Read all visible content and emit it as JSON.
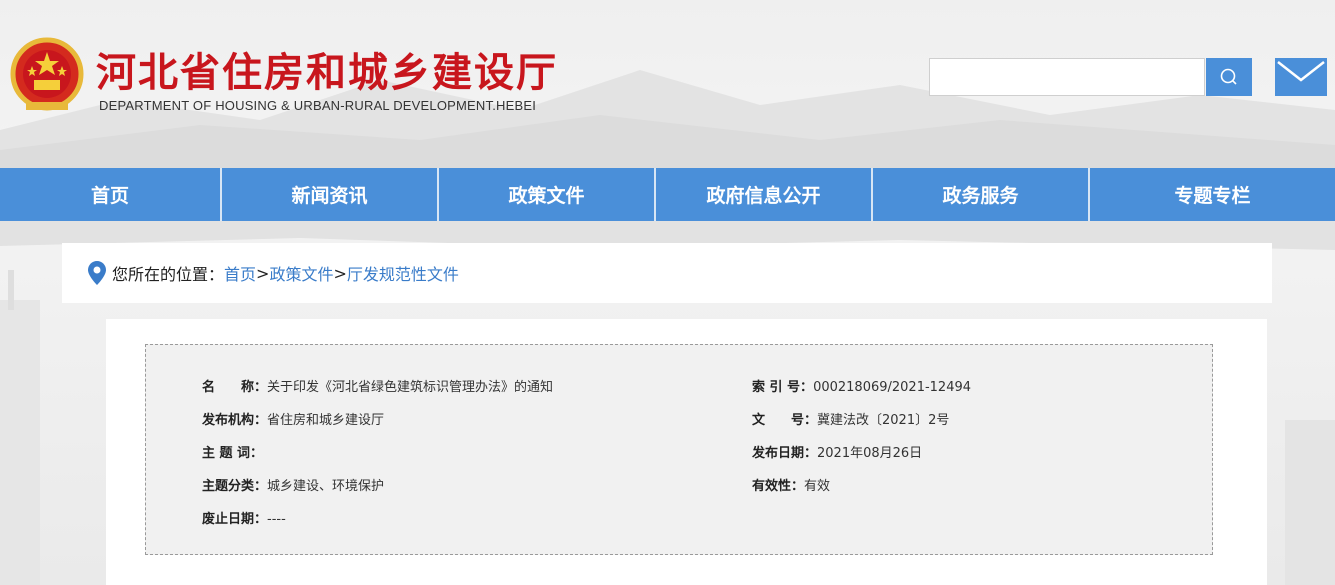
{
  "header": {
    "title": "河北省住房和城乡建设厅",
    "subtitle": "DEPARTMENT OF HOUSING & URBAN-RURAL DEVELOPMENT.HEBEI",
    "search": {
      "value": "",
      "placeholder": ""
    },
    "icons": {
      "search": "search-icon",
      "mail": "mail-icon",
      "emblem": "national-emblem-icon"
    }
  },
  "nav": {
    "items": [
      {
        "label": "首页"
      },
      {
        "label": "新闻资讯"
      },
      {
        "label": "政策文件"
      },
      {
        "label": "政府信息公开"
      },
      {
        "label": "政务服务"
      },
      {
        "label": "专题专栏"
      }
    ]
  },
  "breadcrumb": {
    "prefix": "您所在的位置：",
    "items": [
      "首页",
      "政策文件",
      "厅发规范性文件"
    ],
    "separator": ">"
  },
  "meta": {
    "name": {
      "key": "名　　称：",
      "value": "关于印发《河北省绿色建筑标识管理办法》的通知"
    },
    "index": {
      "key": "索 引 号：",
      "value": "000218069/2021-12494"
    },
    "publisher": {
      "key": "发布机构：",
      "value": "省住房和城乡建设厅"
    },
    "doc_no": {
      "key": "文　　号：",
      "value": "冀建法改〔2021〕2号"
    },
    "subject_words": {
      "key": "主 题 词：",
      "value": ""
    },
    "publish_date": {
      "key": "发布日期：",
      "value": "2021年08月26日"
    },
    "category": {
      "key": "主题分类：",
      "value": "城乡建设、环境保护"
    },
    "validity": {
      "key": "有效性：",
      "value": "有效"
    },
    "abolish_date": {
      "key": "废止日期：",
      "value": "----"
    }
  },
  "colors": {
    "brand_red": "#c8161d",
    "nav_blue": "#4a8fd9",
    "link_blue": "#3a7cc9"
  }
}
